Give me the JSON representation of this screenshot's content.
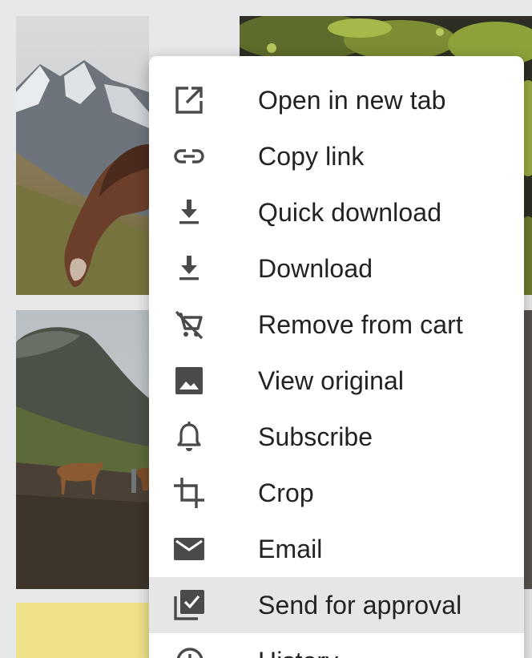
{
  "colors": {
    "menu_background": "#ffffff",
    "menu_highlight": "#e6e6e6",
    "icon_color": "#4a4a4a",
    "text_color": "#222222",
    "page_background": "#e7e8ea"
  },
  "gallery": {
    "tiles": [
      {
        "name": "horse-grazing-mountains-photo"
      },
      {
        "name": "mossy-rock-photo"
      },
      {
        "name": "horses-in-valley-photo"
      },
      {
        "name": "yellow-tile"
      },
      {
        "name": "dark-tile"
      }
    ]
  },
  "context_menu": {
    "items": [
      {
        "label": "Open in new tab",
        "icon": "open-in-new-tab-icon"
      },
      {
        "label": "Copy link",
        "icon": "link-icon"
      },
      {
        "label": "Quick download",
        "icon": "quick-download-icon"
      },
      {
        "label": "Download",
        "icon": "download-icon"
      },
      {
        "label": "Remove from cart",
        "icon": "remove-from-cart-icon"
      },
      {
        "label": "View original",
        "icon": "image-icon"
      },
      {
        "label": "Subscribe",
        "icon": "bell-icon"
      },
      {
        "label": "Crop",
        "icon": "crop-icon"
      },
      {
        "label": "Email",
        "icon": "envelope-icon"
      },
      {
        "label": "Send for approval",
        "icon": "send-for-approval-icon",
        "highlighted": true
      },
      {
        "label": "History",
        "icon": "history-icon"
      }
    ]
  }
}
